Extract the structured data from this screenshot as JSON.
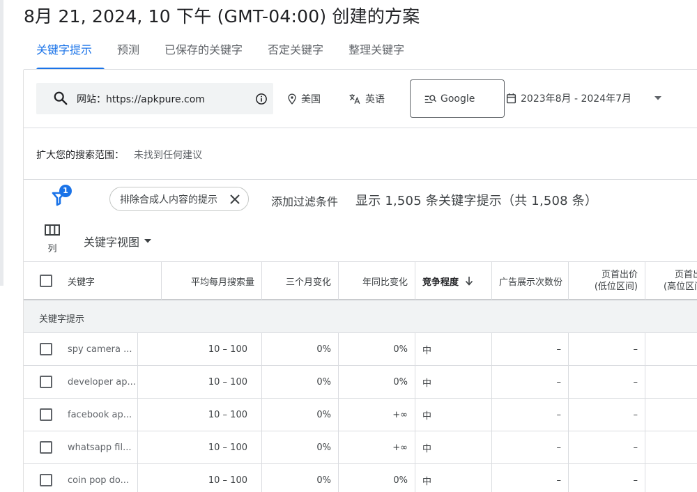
{
  "page": {
    "title": "8月 21, 2024, 10 下午 (GMT-04:00) 创建的方案"
  },
  "tabs": [
    {
      "label": "关键字提示",
      "active": true
    },
    {
      "label": "预测"
    },
    {
      "label": "已保存的关键字"
    },
    {
      "label": "否定关键字"
    },
    {
      "label": "整理关键字"
    }
  ],
  "search": {
    "site_text": "网站：https://apkpure.com"
  },
  "location": {
    "label": "美国",
    "icon": "location-pin-icon"
  },
  "language": {
    "label": "英语",
    "icon": "translate-icon"
  },
  "engine": {
    "label": "Google",
    "icon": "search-engine-icon"
  },
  "date_range": {
    "label": "2023年8月 - 2024年7月",
    "icon": "calendar-icon"
  },
  "broaden": {
    "label": "扩大您的搜索范围：",
    "value": "未找到任何建议"
  },
  "filters": {
    "badge_count": "1",
    "chip_label": "排除合成人内容的提示",
    "add_filter": "添加过滤条件",
    "result_count": "显示 1,505 条关键字提示（共 1,508 条）"
  },
  "toolbar": {
    "columns_label": "列",
    "view_label": "关键字视图"
  },
  "table": {
    "headers": {
      "keyword": "关键字",
      "avg_monthly": "平均每月搜索量",
      "three_month": "三个月变化",
      "yoy": "年同比变化",
      "competition": "竞争程度",
      "impression_share": "广告展示次数份",
      "top_bid_low_1": "页首出价",
      "top_bid_low_2": "(低位区间)",
      "top_bid_high_1": "页首出",
      "top_bid_high_2": "(高位区间"
    },
    "group_label": "关键字提示",
    "rows": [
      {
        "keyword": "spy camera ...",
        "avg": "10 – 100",
        "three_month": "0%",
        "yoy": "0%",
        "competition": "中",
        "impression": "–",
        "low": "–"
      },
      {
        "keyword": "developer ap...",
        "avg": "10 – 100",
        "three_month": "0%",
        "yoy": "0%",
        "competition": "中",
        "impression": "–",
        "low": "–"
      },
      {
        "keyword": "facebook ap...",
        "avg": "10 – 100",
        "three_month": "0%",
        "yoy": "+∞",
        "competition": "中",
        "impression": "–",
        "low": "–"
      },
      {
        "keyword": "whatsapp fil...",
        "avg": "10 – 100",
        "three_month": "0%",
        "yoy": "+∞",
        "competition": "中",
        "impression": "–",
        "low": "–"
      },
      {
        "keyword": "coin pop do...",
        "avg": "10 – 100",
        "three_month": "0%",
        "yoy": "0%",
        "competition": "中",
        "impression": "–",
        "low": "–"
      }
    ]
  },
  "colors": {
    "accent": "#1a73e8",
    "text": "#3c4043",
    "divider": "#dadce0",
    "group_bg": "#f1f3f4"
  }
}
